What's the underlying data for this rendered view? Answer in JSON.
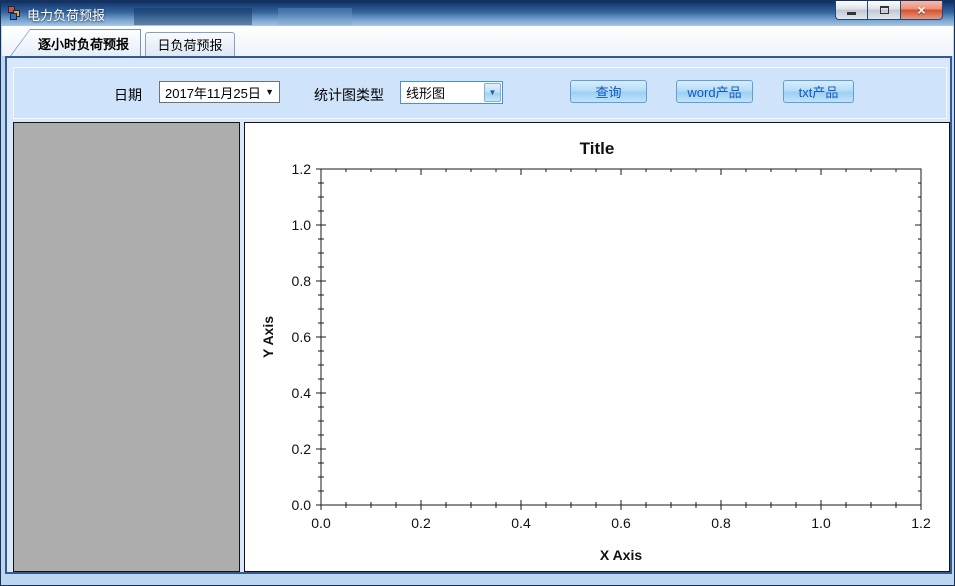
{
  "window": {
    "title": "电力负荷预报"
  },
  "icons": {
    "close": "×",
    "dropdown": "▼"
  },
  "tabs": [
    {
      "label": "逐小时负荷预报",
      "selected": true
    },
    {
      "label": "日负荷预报",
      "selected": false
    }
  ],
  "toolbar": {
    "date_label": "日期",
    "date_value": "2017年11月25日",
    "chart_type_label": "统计图类型",
    "chart_type_value": "线形图",
    "query_button": "查询",
    "word_button": "word产品",
    "txt_button": "txt产品"
  },
  "colors": {
    "accent_blue": "#5da0d8",
    "button_text": "#1257c4",
    "page_background": "#d8e7fb",
    "left_panel_gray": "#adadad",
    "titlebar_navy": "#10305c",
    "close_red": "#d4502f"
  },
  "chart_data": {
    "type": "line",
    "title": "Title",
    "xlabel": "X Axis",
    "ylabel": "Y Axis",
    "xlim": [
      0.0,
      1.2
    ],
    "ylim": [
      0.0,
      1.2
    ],
    "x_ticks": [
      0.0,
      0.2,
      0.4,
      0.6,
      0.8,
      1.0,
      1.2
    ],
    "y_ticks": [
      0.0,
      0.2,
      0.4,
      0.6,
      0.8,
      1.0,
      1.2
    ],
    "x_tick_labels": [
      "0.0",
      "0.2",
      "0.4",
      "0.6",
      "0.8",
      "1.0",
      "1.2"
    ],
    "y_tick_labels": [
      "0.0",
      "0.2",
      "0.4",
      "0.6",
      "0.8",
      "1.0",
      "1.2"
    ],
    "minor_tick_step": 0.05,
    "grid": false,
    "legend": null,
    "series": []
  }
}
